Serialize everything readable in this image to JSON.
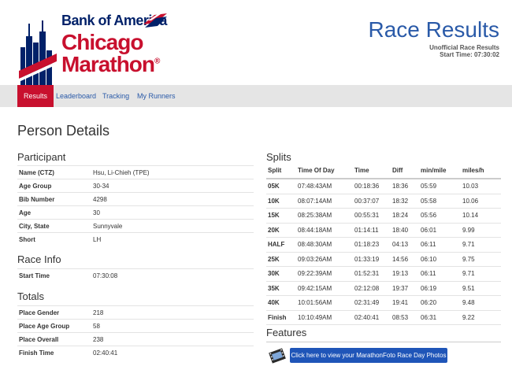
{
  "brand": {
    "sponsor": "Bank of America",
    "event_line1": "Chicago",
    "event_line2": "Marathon",
    "registered": "®",
    "colors": {
      "red": "#c8102e",
      "navy": "#012169",
      "link": "#2a5aa8"
    }
  },
  "header": {
    "title": "Race Results",
    "subtitle": "Unofficial Race Results",
    "start_time": "Start Time: 07:30:02"
  },
  "nav": {
    "items": [
      {
        "label": "Results",
        "active": true
      },
      {
        "label": "Leaderboard",
        "active": false
      },
      {
        "label": "Tracking",
        "active": false
      },
      {
        "label": "My Runners",
        "active": false
      }
    ]
  },
  "page_title": "Person Details",
  "participant": {
    "title": "Participant",
    "rows": [
      {
        "k": "Name (CTZ)",
        "v": "Hsu, Li-Chieh (TPE)"
      },
      {
        "k": "Age Group",
        "v": "30-34"
      },
      {
        "k": "Bib Number",
        "v": "4298"
      },
      {
        "k": "Age",
        "v": "30"
      },
      {
        "k": "City, State",
        "v": "Sunnyvale"
      },
      {
        "k": "Short",
        "v": "LH"
      }
    ]
  },
  "race_info": {
    "title": "Race Info",
    "rows": [
      {
        "k": "Start Time",
        "v": "07:30:08"
      }
    ]
  },
  "totals": {
    "title": "Totals",
    "rows": [
      {
        "k": "Place Gender",
        "v": "218"
      },
      {
        "k": "Place Age Group",
        "v": "58"
      },
      {
        "k": "Place Overall",
        "v": "238"
      },
      {
        "k": "Finish Time",
        "v": "02:40:41"
      }
    ]
  },
  "splits": {
    "title": "Splits",
    "headers": [
      "Split",
      "Time Of Day",
      "Time",
      "Diff",
      "min/mile",
      "miles/h"
    ],
    "rows": [
      [
        "05K",
        "07:48:43AM",
        "00:18:36",
        "18:36",
        "05:59",
        "10.03"
      ],
      [
        "10K",
        "08:07:14AM",
        "00:37:07",
        "18:32",
        "05:58",
        "10.06"
      ],
      [
        "15K",
        "08:25:38AM",
        "00:55:31",
        "18:24",
        "05:56",
        "10.14"
      ],
      [
        "20K",
        "08:44:18AM",
        "01:14:11",
        "18:40",
        "06:01",
        "9.99"
      ],
      [
        "HALF",
        "08:48:30AM",
        "01:18:23",
        "04:13",
        "06:11",
        "9.71"
      ],
      [
        "25K",
        "09:03:26AM",
        "01:33:19",
        "14:56",
        "06:10",
        "9.75"
      ],
      [
        "30K",
        "09:22:39AM",
        "01:52:31",
        "19:13",
        "06:11",
        "9.71"
      ],
      [
        "35K",
        "09:42:15AM",
        "02:12:08",
        "19:37",
        "06:19",
        "9.51"
      ],
      [
        "40K",
        "10:01:56AM",
        "02:31:49",
        "19:41",
        "06:20",
        "9.48"
      ],
      [
        "Finish",
        "10:10:49AM",
        "02:40:41",
        "08:53",
        "06:31",
        "9.22"
      ]
    ]
  },
  "features": {
    "title": "Features",
    "icon": "film-icon",
    "photo_button": "Click here to view your MarathonFoto Race Day Photos"
  }
}
